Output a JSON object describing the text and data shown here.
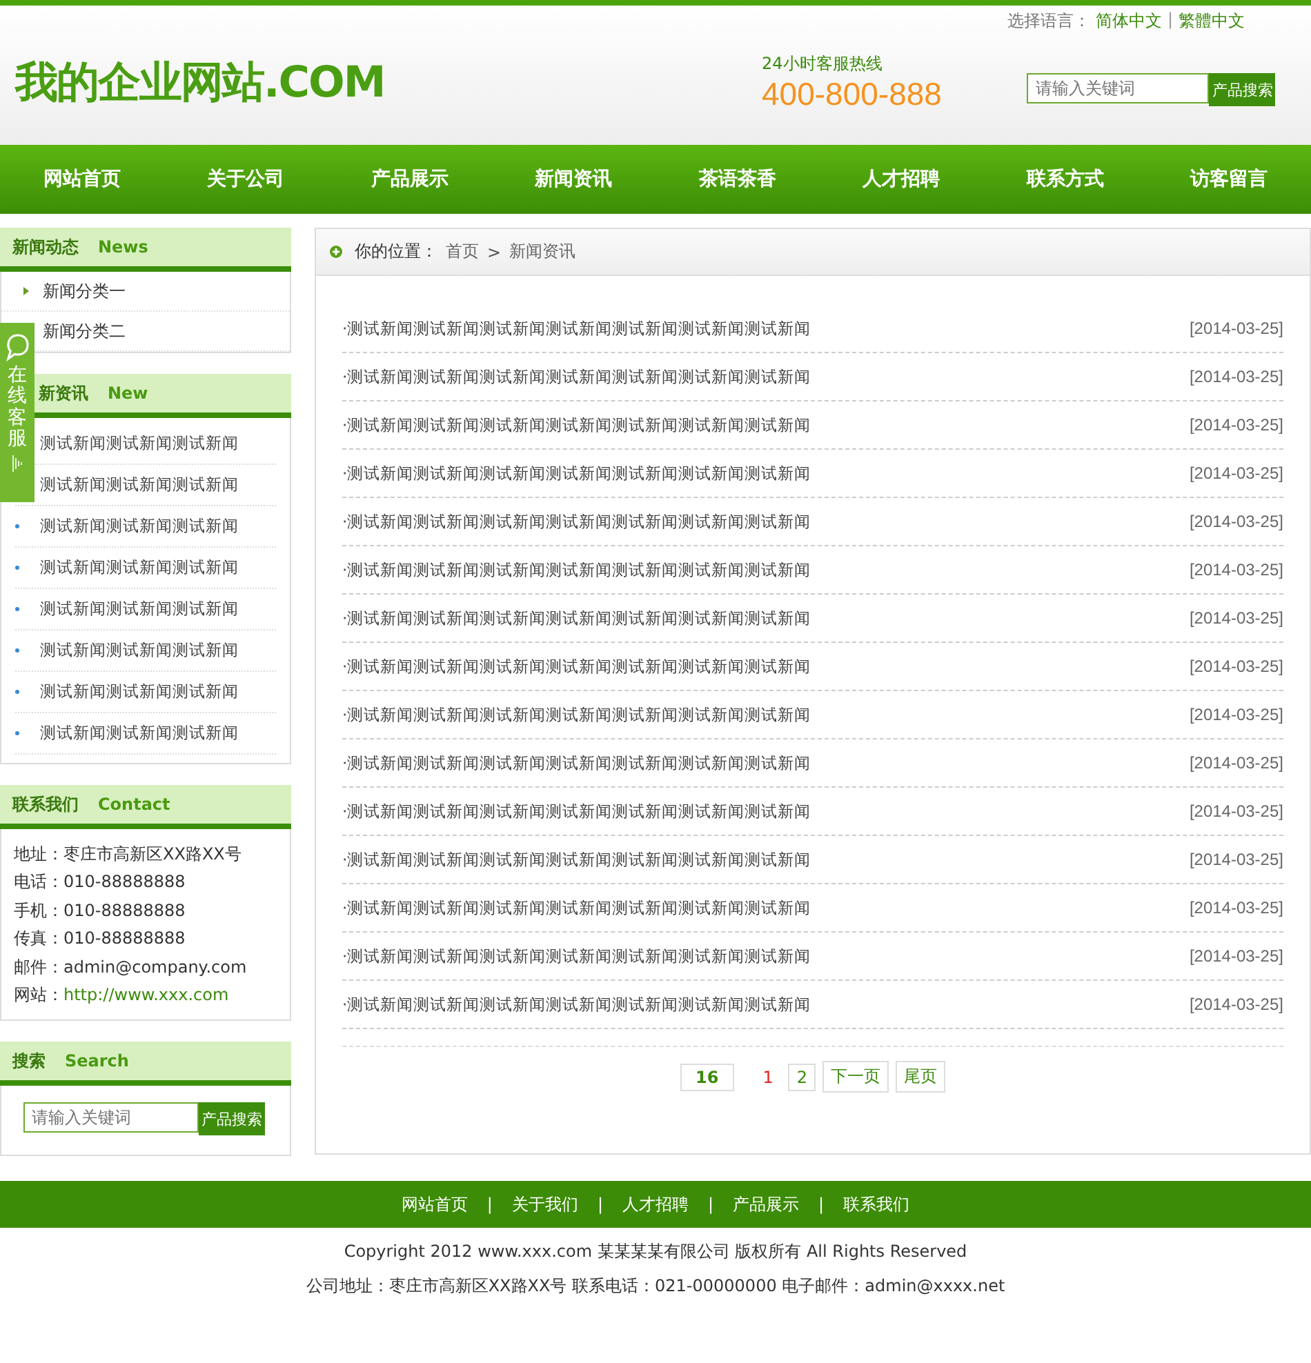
{
  "header": {
    "language_label": "选择语言：",
    "languages": [
      {
        "label": "简体中文"
      },
      {
        "label": "繁體中文"
      }
    ],
    "language_separator": "|",
    "logo": "我的企业网站.COM",
    "hotline_label": "24小时客服热线",
    "hotline": "400-800-888",
    "search": {
      "placeholder": "请输入关键词",
      "button": "产品搜索"
    }
  },
  "nav": [
    {
      "label": "网站首页"
    },
    {
      "label": "关于公司"
    },
    {
      "label": "产品展示"
    },
    {
      "label": "新闻资讯"
    },
    {
      "label": "茶语茶香"
    },
    {
      "label": "人才招聘"
    },
    {
      "label": "联系方式"
    },
    {
      "label": "访客留言"
    }
  ],
  "sidebar": {
    "categories": {
      "title": "新闻动态",
      "title_en": "News",
      "items": [
        "新闻分类一",
        "新闻分类二"
      ]
    },
    "latest": {
      "title": "新资讯",
      "title_en": "New",
      "items": [
        "测试新闻测试新闻测试新闻",
        "测试新闻测试新闻测试新闻",
        "测试新闻测试新闻测试新闻",
        "测试新闻测试新闻测试新闻",
        "测试新闻测试新闻测试新闻",
        "测试新闻测试新闻测试新闻",
        "测试新闻测试新闻测试新闻",
        "测试新闻测试新闻测试新闻"
      ]
    },
    "contact": {
      "title": "联系我们",
      "title_en": "Contact",
      "lines": [
        {
          "label": "地址：",
          "value": "枣庄市高新区XX路XX号",
          "kind": "text"
        },
        {
          "label": "电话：",
          "value": "010-88888888",
          "kind": "text"
        },
        {
          "label": "手机：",
          "value": "010-88888888",
          "kind": "text"
        },
        {
          "label": "传真：",
          "value": "010-88888888",
          "kind": "text"
        },
        {
          "label": "邮件：",
          "value": "admin@company.com",
          "kind": "text"
        },
        {
          "label": "网站：",
          "value": "http://www.xxx.com",
          "kind": "link"
        }
      ]
    },
    "search": {
      "title": "搜索",
      "title_en": "Search",
      "placeholder": "请输入关键词",
      "button": "产品搜索"
    }
  },
  "floating_service": {
    "label": "在线客服"
  },
  "breadcrumb": {
    "label": "你的位置：",
    "items": [
      "首页",
      "新闻资讯"
    ],
    "separator": ">"
  },
  "news": [
    {
      "title": "·测试新闻测试新闻测试新闻测试新闻测试新闻测试新闻测试新闻",
      "date": "[2014-03-25]"
    },
    {
      "title": "·测试新闻测试新闻测试新闻测试新闻测试新闻测试新闻测试新闻",
      "date": "[2014-03-25]"
    },
    {
      "title": "·测试新闻测试新闻测试新闻测试新闻测试新闻测试新闻测试新闻",
      "date": "[2014-03-25]"
    },
    {
      "title": "·测试新闻测试新闻测试新闻测试新闻测试新闻测试新闻测试新闻",
      "date": "[2014-03-25]"
    },
    {
      "title": "·测试新闻测试新闻测试新闻测试新闻测试新闻测试新闻测试新闻",
      "date": "[2014-03-25]"
    },
    {
      "title": "·测试新闻测试新闻测试新闻测试新闻测试新闻测试新闻测试新闻",
      "date": "[2014-03-25]"
    },
    {
      "title": "·测试新闻测试新闻测试新闻测试新闻测试新闻测试新闻测试新闻",
      "date": "[2014-03-25]"
    },
    {
      "title": "·测试新闻测试新闻测试新闻测试新闻测试新闻测试新闻测试新闻",
      "date": "[2014-03-25]"
    },
    {
      "title": "·测试新闻测试新闻测试新闻测试新闻测试新闻测试新闻测试新闻",
      "date": "[2014-03-25]"
    },
    {
      "title": "·测试新闻测试新闻测试新闻测试新闻测试新闻测试新闻测试新闻",
      "date": "[2014-03-25]"
    },
    {
      "title": "·测试新闻测试新闻测试新闻测试新闻测试新闻测试新闻测试新闻",
      "date": "[2014-03-25]"
    },
    {
      "title": "·测试新闻测试新闻测试新闻测试新闻测试新闻测试新闻测试新闻",
      "date": "[2014-03-25]"
    },
    {
      "title": "·测试新闻测试新闻测试新闻测试新闻测试新闻测试新闻测试新闻",
      "date": "[2014-03-25]"
    },
    {
      "title": "·测试新闻测试新闻测试新闻测试新闻测试新闻测试新闻测试新闻",
      "date": "[2014-03-25]"
    },
    {
      "title": "·测试新闻测试新闻测试新闻测试新闻测试新闻测试新闻测试新闻",
      "date": "[2014-03-25]"
    }
  ],
  "pagination": {
    "total": "16",
    "pages": [
      {
        "label": "1",
        "selected": true
      },
      {
        "label": "2",
        "selected": false
      }
    ],
    "next": "下一页",
    "last": "尾页"
  },
  "footer": {
    "links": [
      "网站首页",
      "关于我们",
      "人才招聘",
      "产品展示",
      "联系我们"
    ],
    "separator": "|",
    "copyright": "Copyright 2012 www.xxx.com 某某某某有限公司 版权所有 All Rights Reserved",
    "address": "公司地址：枣庄市高新区XX路XX号 联系电话：021-00000000 电子邮件：admin@xxxx.net"
  }
}
